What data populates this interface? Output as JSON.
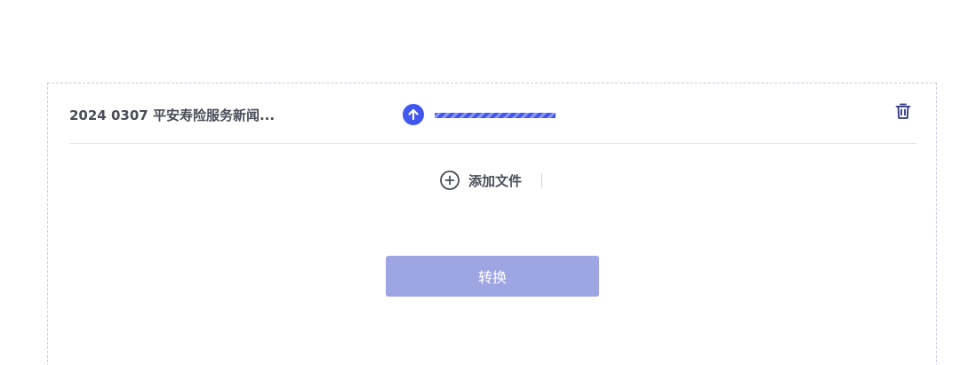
{
  "file": {
    "name": "2024 0307 平安寿险服务新闻...",
    "upload_progress": 1.0,
    "status_icon": "upload-arrow-icon",
    "delete_icon": "trash-icon"
  },
  "actions": {
    "add_file_label": "添加文件",
    "add_file_icon": "plus-circle-icon",
    "convert_label": "转换",
    "convert_enabled": false
  },
  "colors": {
    "accent": "#4257f0",
    "accent_stripe": "#8c98f6",
    "button_disabled": "#9ea5e3",
    "text": "#4a4d57",
    "border": "#c7cbe8"
  }
}
